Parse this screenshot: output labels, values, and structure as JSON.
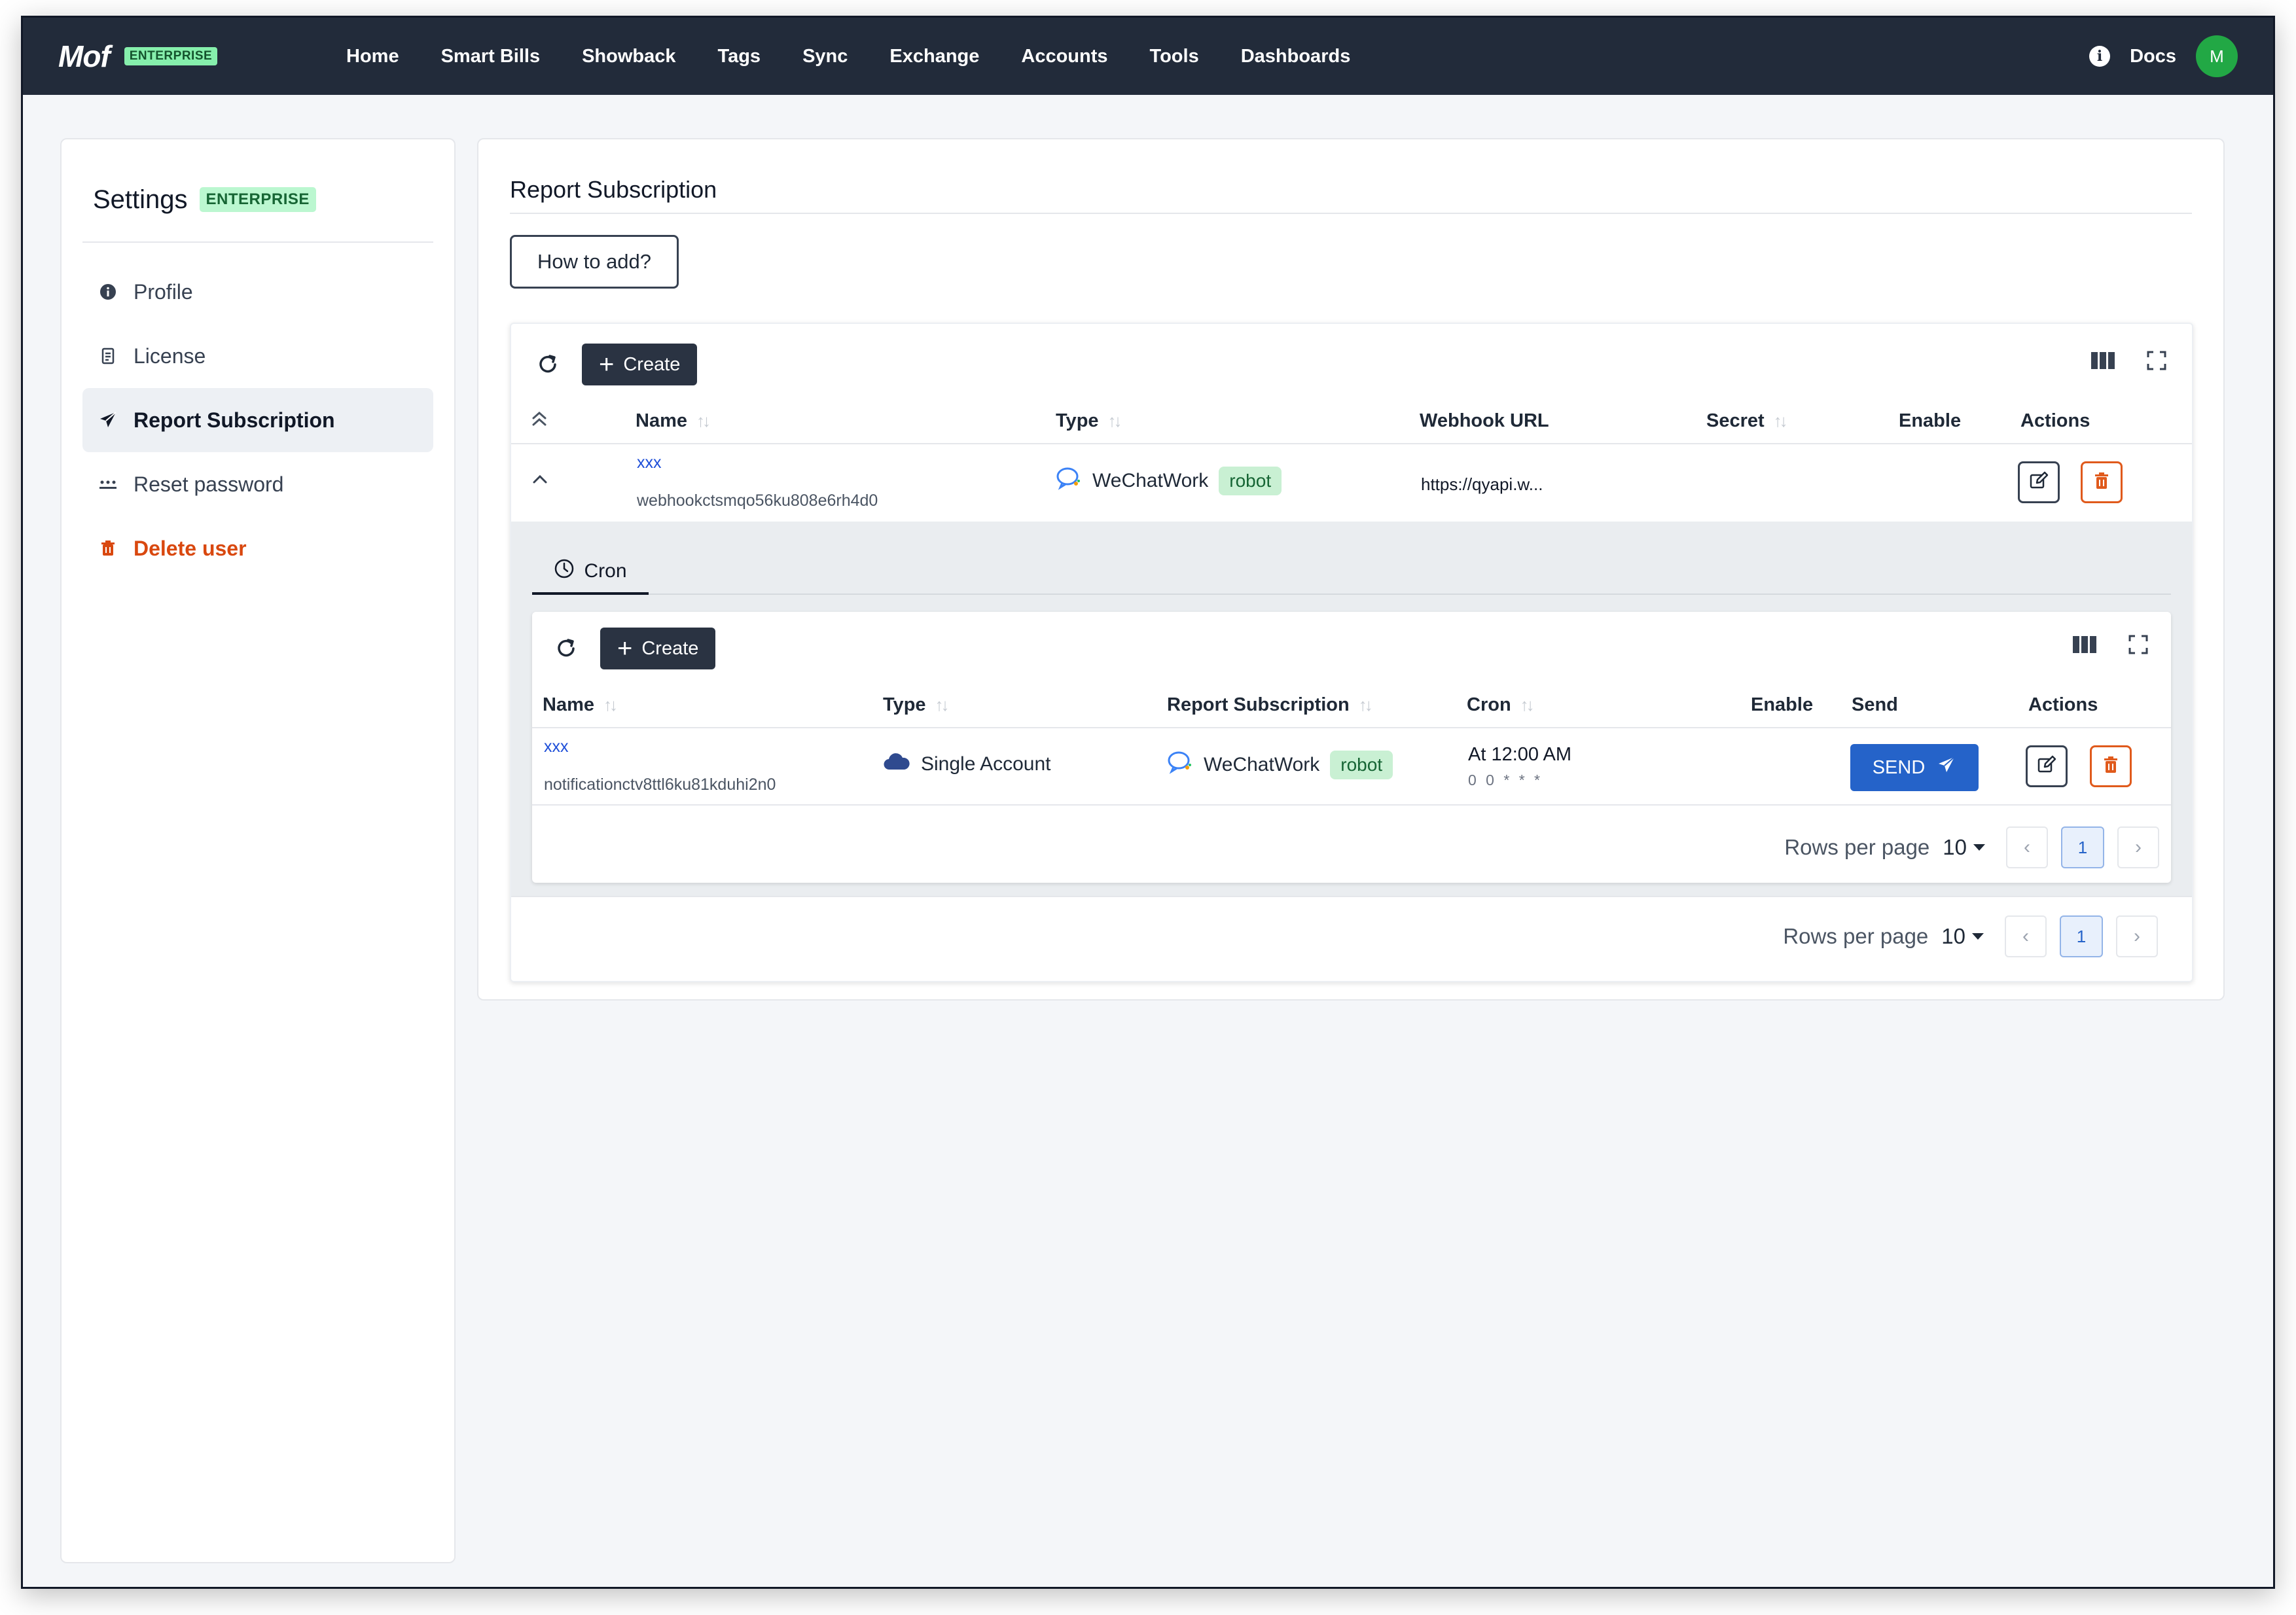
{
  "nav": {
    "brand": "Mof",
    "brand_badge": "ENTERPRISE",
    "items": [
      "Home",
      "Smart Bills",
      "Showback",
      "Tags",
      "Sync",
      "Exchange",
      "Accounts",
      "Tools",
      "Dashboards"
    ],
    "docs": "Docs",
    "avatar_initial": "M"
  },
  "sidebar": {
    "title": "Settings",
    "badge": "ENTERPRISE",
    "items": [
      {
        "label": "Profile",
        "icon": "info-circle-icon"
      },
      {
        "label": "License",
        "icon": "license-icon"
      },
      {
        "label": "Report Subscription",
        "icon": "send-icon",
        "active": true
      },
      {
        "label": "Reset password",
        "icon": "password-dots-icon"
      },
      {
        "label": "Delete user",
        "icon": "trash-icon",
        "danger": true
      }
    ]
  },
  "main": {
    "title": "Report Subscription",
    "how_to_add": "How to add?",
    "create_label": "Create",
    "columns": {
      "name": "Name",
      "type": "Type",
      "webhook_url": "Webhook URL",
      "secret": "Secret",
      "enable": "Enable",
      "actions": "Actions"
    },
    "rows": [
      {
        "name": "xxx",
        "id": "webhookctsmqo56ku808e6rh4d0",
        "type": "WeChatWork",
        "type_tag": "robot",
        "webhook_url": "https://qyapi.w...",
        "secret": "",
        "enabled": true
      }
    ],
    "expanded": {
      "tab_label": "Cron",
      "create_label": "Create",
      "columns": {
        "name": "Name",
        "type": "Type",
        "report_subscription": "Report Subscription",
        "cron": "Cron",
        "enable": "Enable",
        "send": "Send",
        "actions": "Actions"
      },
      "rows": [
        {
          "name": "xxx",
          "id": "notificationctv8ttl6ku81kduhi2n0",
          "type": "Single Account",
          "report_subscription": "WeChatWork",
          "report_tag": "robot",
          "cron_text": "At 12:00 AM",
          "cron_expr": "0 0 * * *",
          "enabled": true,
          "send_label": "SEND"
        }
      ],
      "pager": {
        "rows_per_page_label": "Rows per page",
        "rows_per_page": "10",
        "page": "1"
      }
    },
    "pager": {
      "rows_per_page_label": "Rows per page",
      "rows_per_page": "10",
      "page": "1"
    }
  },
  "colors": {
    "nav_bg": "#222b3a",
    "accent_blue": "#2563c9",
    "danger": "#d9480f",
    "chip_green": "#c9f0d3"
  }
}
